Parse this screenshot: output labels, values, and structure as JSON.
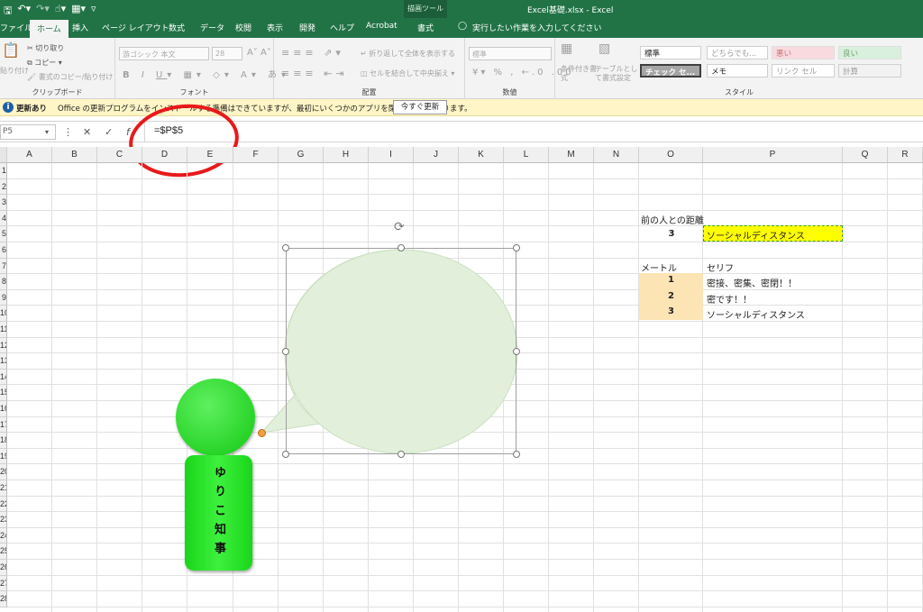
{
  "colors": {
    "excel_green": "#217346",
    "bubble_fill": "#e2efda",
    "person_green": "#1fe01f",
    "social_yellow": "#ffff00",
    "meter_fill": "#fce4b4",
    "annotation_red": "#e8191b"
  },
  "titlebar": {
    "qat_icons": [
      "save-icon",
      "undo-icon",
      "redo-icon",
      "touch-icon",
      "form-icon",
      "customize-icon"
    ],
    "context_tool": "描画ツール",
    "window_title": "Excel基礎.xlsx  -  Excel"
  },
  "tabs": [
    "ファイル",
    "ホーム",
    "挿入",
    "ページ レイアウト",
    "数式",
    "データ",
    "校閲",
    "表示",
    "開発",
    "ヘルプ",
    "Acrobat",
    "書式"
  ],
  "tell_me": "実行したい作業を入力してください",
  "ribbon": {
    "clipboard": {
      "paste": "貼り付け",
      "cut": "切り取り",
      "copy": "コピー",
      "format_painter": "書式のコピー/貼り付け",
      "label": "クリップボード"
    },
    "font": {
      "font_name": "游ゴシック 本文",
      "font_size": "28",
      "label": "フォント"
    },
    "alignment": {
      "wrap": "折り返して全体を表示する",
      "merge": "セルを結合して中央揃え",
      "label": "配置"
    },
    "number": {
      "format": "標準",
      "label": "数値"
    },
    "styles": {
      "cond_format": "条件付き書式",
      "table_format": "テーブルとして書式設定",
      "cells": [
        "標準",
        "どちらでも...",
        "悪い",
        "良い",
        "チェック セ...",
        "メモ",
        "リンク セル",
        "計算"
      ],
      "label": "スタイル"
    }
  },
  "message_bar": {
    "label": "更新あり",
    "message": "Office の更新プログラムをインストールする準備はできていますが、最初にいくつかのアプリを閉じる必要があります。",
    "button": "今すぐ更新"
  },
  "formula_bar": {
    "name_box": "P5",
    "formula": "=$P$5"
  },
  "columns": [
    "A",
    "B",
    "C",
    "D",
    "E",
    "F",
    "G",
    "H",
    "I",
    "J",
    "K",
    "L",
    "M",
    "N",
    "O",
    "P",
    "Q",
    "R"
  ],
  "rows": [
    "1",
    "2",
    "3",
    "4",
    "5",
    "6",
    "7",
    "8",
    "9",
    "10",
    "11",
    "12",
    "13",
    "14",
    "15",
    "16",
    "17",
    "18",
    "19",
    "20",
    "21",
    "22",
    "23",
    "24",
    "25",
    "26",
    "27",
    "28"
  ],
  "sheet": {
    "distance_label": "前の人との距離",
    "distance_value": "3",
    "result": "ソーシャルディスタンス",
    "table_headers": [
      "メートル",
      "セリフ"
    ],
    "table_rows": [
      [
        "1",
        "密接、密集、密閉！！"
      ],
      [
        "2",
        "密です！！"
      ],
      [
        "3",
        "ソーシャルディスタンス"
      ]
    ]
  },
  "person_label": "ゆりこ知事"
}
